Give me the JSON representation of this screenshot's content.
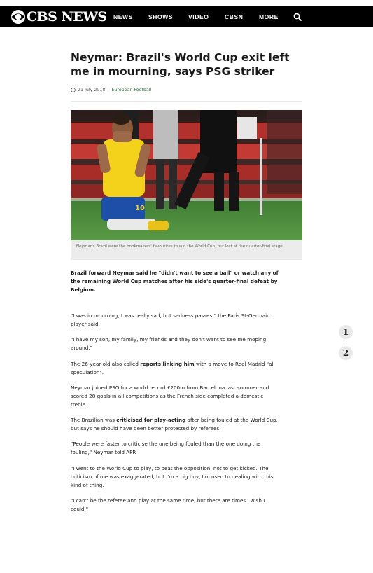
{
  "brand": {
    "name": "CBS NEWS"
  },
  "nav": {
    "items": [
      "NEWS",
      "SHOWS",
      "VIDEO",
      "CBSN",
      "MORE"
    ],
    "search_icon": "search-icon"
  },
  "article": {
    "title": "Neymar: Brazil's World Cup exit left me in mourning, says PSG striker",
    "date": "21 July 2018",
    "category": "European Football",
    "caption": "Neymar's Brazil were the bookmakers' favourites to win the World Cup, but lost at the quarter-final stage",
    "lead": "Brazil forward Neymar said he \"didn't want to see a ball\" or watch any of the remaining World Cup matches after his side's quarter-final defeat by Belgium.",
    "p1": "\"I was in mourning, I was really sad, but sadness passes,\" the Paris St-Germain player said.",
    "p2": "\"I have my son, my family, my friends and they don't want to see me moping around.\"",
    "p3": {
      "pre": "The 26-year-old also called ",
      "link": "reports linking him",
      "post": " with a move to Real Madrid \"all speculation\"."
    },
    "p4": "Neymar joined PSG for a world record £200m from Barcelona last summer and scored 28 goals in all competitions as the French side completed a domestic treble.",
    "p5": {
      "pre": "The Brazilian was ",
      "link": "criticised for play-acting",
      "post": " after being fouled at the World Cup, but says he should have been better protected by referees."
    },
    "p6": "\"People were faster to criticise the one being fouled than the one doing the fouling,\" Neymar told AFP.",
    "p7": "\"I went to the World Cup to play, to beat the opposition, not to get kicked. The criticism of me was exaggerated, but I'm a big boy, I'm used to dealing with this kind of thing.",
    "p8": "\"I can't be the referee and play at the same time, but there are times I wish I could.\""
  },
  "pager": {
    "items": [
      "1",
      "2"
    ]
  },
  "colors": {
    "topbar": "#000000",
    "category": "#2b6b3a",
    "jersey": "#f4d21c",
    "shorts": "#1e4fa8",
    "pitch": "#4a8a3a"
  }
}
